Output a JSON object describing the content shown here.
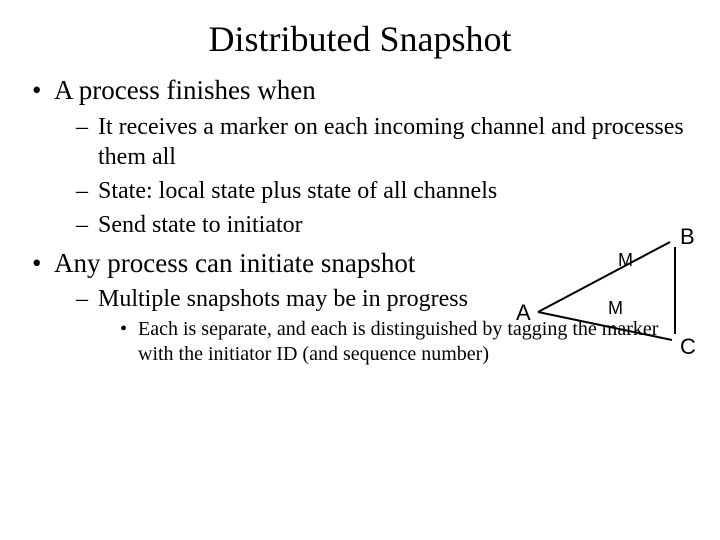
{
  "title": "Distributed Snapshot",
  "bullets": {
    "b1": "A process finishes when",
    "b1_subs": {
      "s1": "It receives a marker on each incoming channel and processes them all",
      "s2": "State: local state plus state of all channels",
      "s3": "Send state to initiator"
    },
    "b2": "Any process can initiate snapshot",
    "b2_subs": {
      "s1": "Multiple snapshots may be in progress",
      "s1_subs": {
        "t1": "Each is separate, and each is distinguished by tagging the marker with the initiator ID (and sequence number)"
      }
    }
  },
  "diagram": {
    "nodes": {
      "A": "A",
      "B": "B",
      "C": "C"
    },
    "edges": {
      "AB_label": "M",
      "AC_label": "M"
    }
  }
}
